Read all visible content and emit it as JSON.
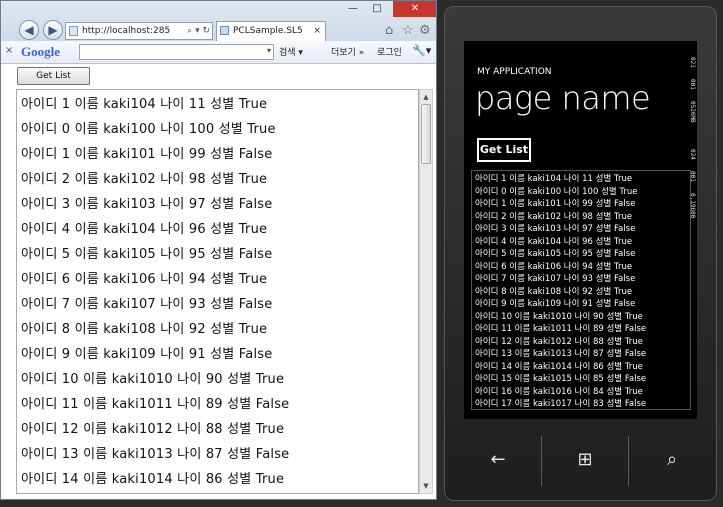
{
  "browser": {
    "address": "http://localhost:285",
    "address_actions": "⌕ ▾ ↻",
    "tab_title": "PCLSample.SL5",
    "tab_close": "×",
    "window_controls": {
      "minimize": "—",
      "maximize": "□",
      "close": "✕"
    },
    "toolbar": {
      "close": "×",
      "google": "Google",
      "dropdown": "▾",
      "search": "검색 ▾",
      "more": "더보기 »",
      "login": "로그인",
      "tools": "🔧▾"
    },
    "content": {
      "button": "Get List",
      "rows": [
        "아이디 1  이름 kaki104  나이 11  성별 True",
        "아이디 0  이름 kaki100  나이 100  성별 True",
        "아이디 1  이름 kaki101  나이 99  성별 False",
        "아이디 2  이름 kaki102  나이 98  성별 True",
        "아이디 3  이름 kaki103  나이 97  성별 False",
        "아이디 4  이름 kaki104  나이 96  성별 True",
        "아이디 5  이름 kaki105  나이 95  성별 False",
        "아이디 6  이름 kaki106  나이 94  성별 True",
        "아이디 7  이름 kaki107  나이 93  성별 False",
        "아이디 8  이름 kaki108  나이 92  성별 True",
        "아이디 9  이름 kaki109  나이 91  성별 False",
        "아이디 10  이름 kaki1010  나이 90  성별 True",
        "아이디 11  이름 kaki1011  나이 89  성별 False",
        "아이디 12  이름 kaki1012  나이 88  성별 True",
        "아이디 13  이름 kaki1013  나이 87  성별 False",
        "아이디 14  이름 kaki1014  나이 86  성별 True"
      ]
    }
  },
  "phone": {
    "app_title": "MY APPLICATION",
    "page_name": "page name",
    "button": "Get List",
    "fps": [
      "021",
      "001",
      "0526MB",
      "024",
      "001",
      "0.19600"
    ],
    "rows": [
      "아이디 1  이름 kaki104  나이 11  성별 True",
      "아이디 0  이름 kaki100  나이 100  성별 True",
      "아이디 1  이름 kaki101  나이 99  성별 False",
      "아이디 2  이름 kaki102  나이 98  성별 True",
      "아이디 3  이름 kaki103  나이 97  성별 False",
      "아이디 4  이름 kaki104  나이 96  성별 True",
      "아이디 5  이름 kaki105  나이 95  성별 False",
      "아이디 6  이름 kaki106  나이 94  성별 True",
      "아이디 7  이름 kaki107  나이 93  성별 False",
      "아이디 8  이름 kaki108  나이 92  성별 True",
      "아이디 9  이름 kaki109  나이 91  성별 False",
      "아이디 10  이름 kaki1010  나이 90  성별 True",
      "아이디 11  이름 kaki1011  나이 89  성별 False",
      "아이디 12  이름 kaki1012  나이 88  성별 True",
      "아이디 13  이름 kaki1013  나이 87  성별 False",
      "아이디 14  이름 kaki1014  나이 86  성별 True",
      "아이디 15  이름 kaki1015  나이 85  성별 False",
      "아이디 16  이름 kaki1016  나이 84  성별 True",
      "아이디 17  이름 kaki1017  나이 83  성별 False"
    ],
    "hw": {
      "back": "←",
      "start": "⊞",
      "search": "⌕"
    }
  }
}
